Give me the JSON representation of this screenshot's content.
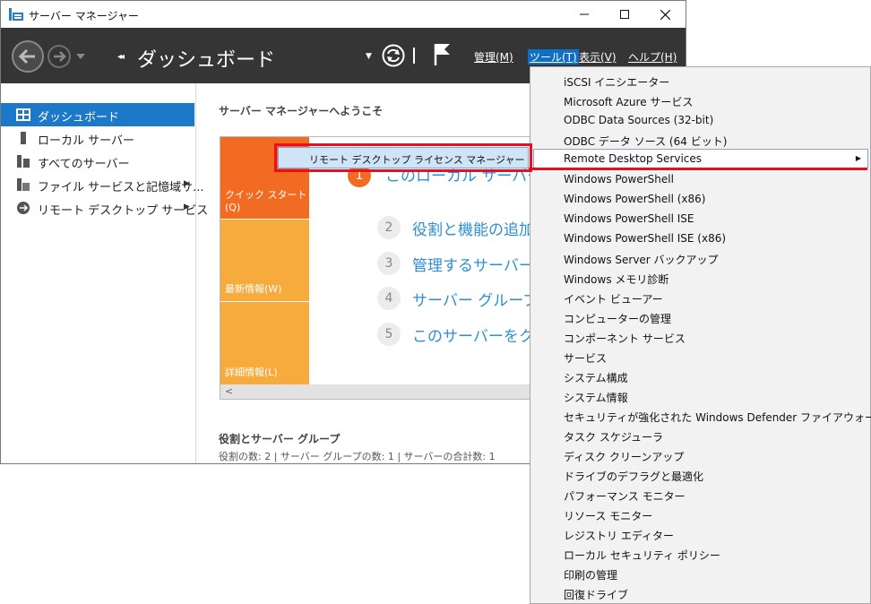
{
  "window": {
    "title": "サーバー マネージャー"
  },
  "header": {
    "title": "ダッシュボード",
    "menus": {
      "manage": "管理(M)",
      "tools": "ツール(T)",
      "view": "表示(V)",
      "help": "ヘルプ(H)"
    }
  },
  "sidebar": {
    "items": [
      {
        "label": "ダッシュボード",
        "icon": "dashboard-icon",
        "active": true
      },
      {
        "label": "ローカル サーバー",
        "icon": "local-server-icon"
      },
      {
        "label": "すべてのサーバー",
        "icon": "all-servers-icon"
      },
      {
        "label": "ファイル サービスと記憶域サ...",
        "icon": "file-services-icon",
        "has_arrow": true
      },
      {
        "label": "リモート デスクトップ サービス",
        "icon": "remote-desktop-icon",
        "has_arrow": true
      }
    ]
  },
  "main": {
    "welcome": "サーバー マネージャーへようこそ",
    "tiles": [
      "クイック スタート(Q)",
      "最新情報(W)",
      "詳細情報(L)"
    ],
    "steps": [
      {
        "num": "1",
        "text": "このローカル サーバー"
      },
      {
        "num": "2",
        "text": "役割と機能の追加"
      },
      {
        "num": "3",
        "text": "管理するサーバーの"
      },
      {
        "num": "4",
        "text": "サーバー グループの"
      },
      {
        "num": "5",
        "text": "このサーバーをクラウ"
      }
    ],
    "roles_title": "役割とサーバー グループ",
    "roles_counts": "役割の数: 2  |  サーバー グループの数: 1  |  サーバーの合計数: 1"
  },
  "tools_menu": {
    "items": [
      "iSCSI イニシエーター",
      "Microsoft Azure サービス",
      "ODBC Data Sources (32-bit)",
      "ODBC データ ソース (64 ビット)",
      "Remote Desktop Services",
      "Windows PowerShell",
      "Windows PowerShell (x86)",
      "Windows PowerShell ISE",
      "Windows PowerShell ISE (x86)",
      "Windows Server バックアップ",
      "Windows メモリ診断",
      "イベント ビューアー",
      "コンピューターの管理",
      "コンポーネント サービス",
      "サービス",
      "システム構成",
      "システム情報",
      "セキュリティが強化された Windows Defender ファイアウォール",
      "タスク スケジューラ",
      "ディスク クリーンアップ",
      "ドライブのデフラグと最適化",
      "パフォーマンス モニター",
      "リソース モニター",
      "レジストリ エディター",
      "ローカル セキュリティ ポリシー",
      "印刷の管理",
      "回復ドライブ"
    ],
    "hovered_index": 4
  },
  "submenu": {
    "item": "リモート デスクトップ ライセンス マネージャー"
  },
  "colors": {
    "header_bg": "#353535",
    "accent_blue": "#1c78c8",
    "quick_start": "#f26b22",
    "tile_light": "#f8ab3d",
    "highlight_red": "#e8101e"
  }
}
